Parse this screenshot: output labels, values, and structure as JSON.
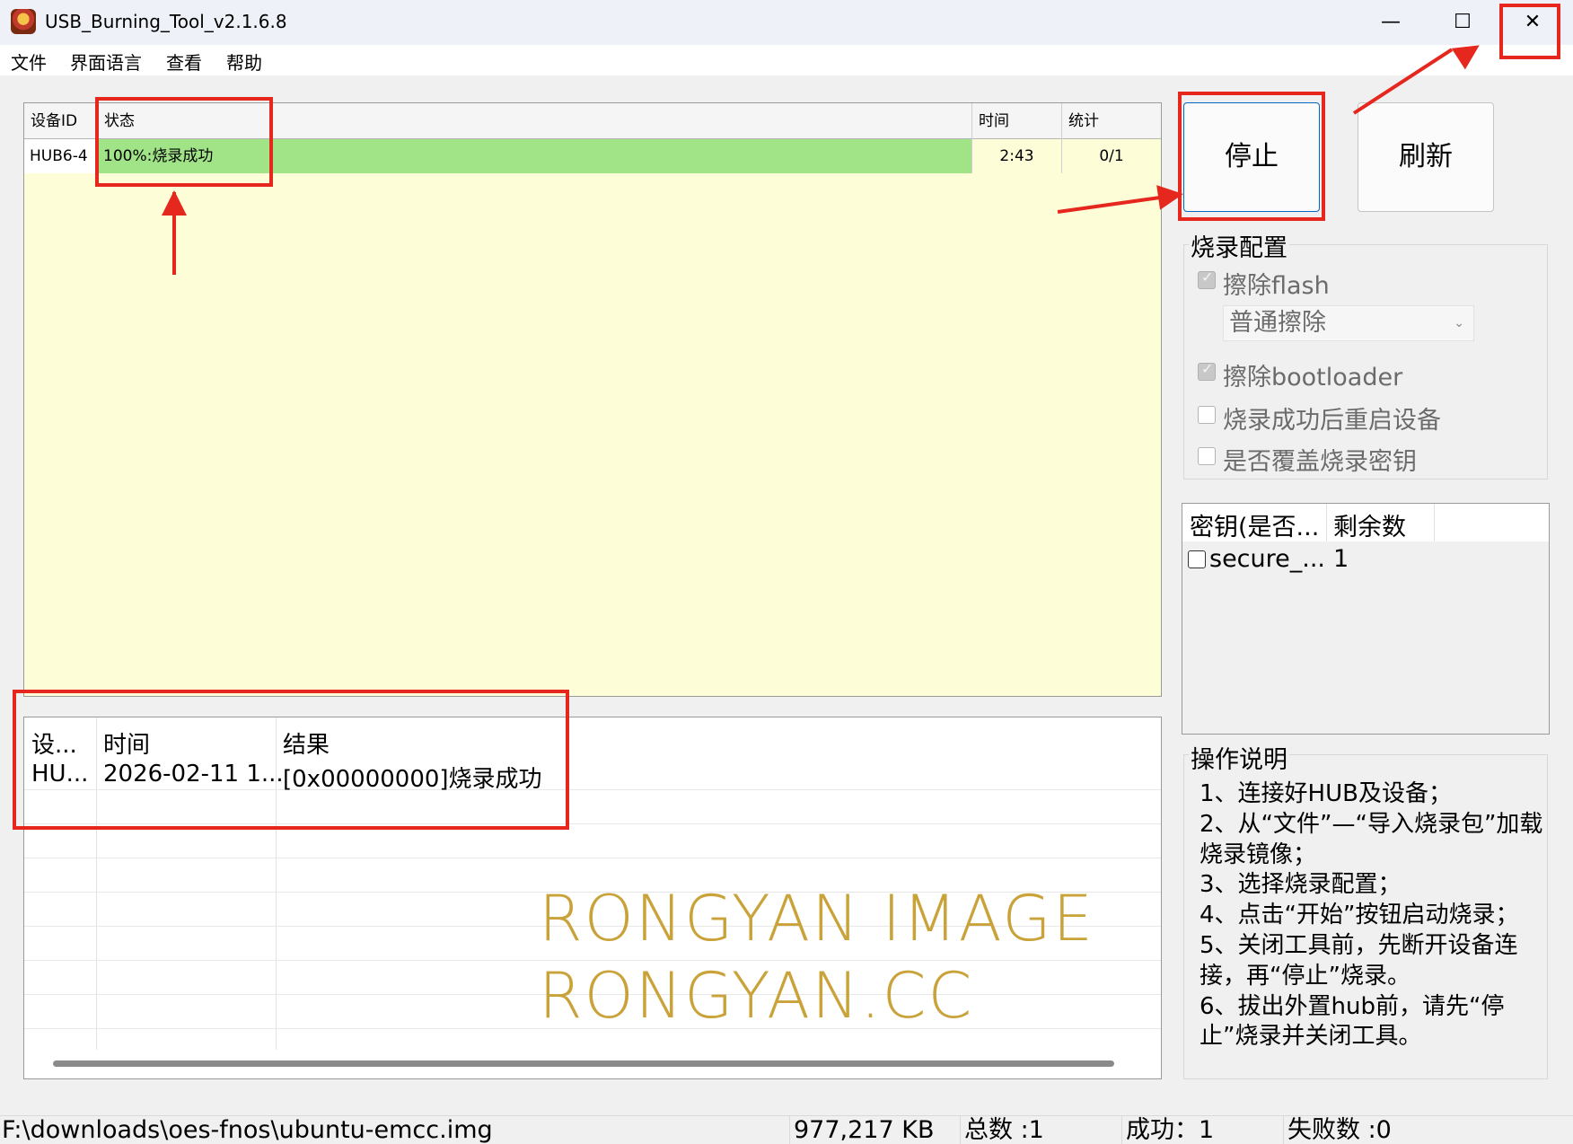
{
  "window": {
    "title": "USB_Burning_Tool_v2.1.6.8",
    "minimize_icon": "minimize-icon",
    "maximize_icon": "maximize-icon",
    "close_icon": "close-icon",
    "minimize_glyph": "—",
    "maximize_glyph": "☐",
    "close_glyph": "✕"
  },
  "menu": [
    "文件",
    "界面语言",
    "查看",
    "帮助"
  ],
  "device_table": {
    "columns": [
      "设备ID",
      "状态",
      "时间",
      "统计"
    ],
    "rows": [
      {
        "device_id": "HUB6-4",
        "status": "100%:烧录成功",
        "time": "2:43",
        "stats": "0/1",
        "status_color": "#a0e487"
      }
    ],
    "background_color": "#fdfdd8"
  },
  "log_table": {
    "columns": [
      "设...",
      "时间",
      "结果"
    ],
    "rows": [
      {
        "device": "HU...",
        "time": "2026-02-11 1...",
        "result": "[0x00000000]烧录成功"
      }
    ]
  },
  "watermark": {
    "line1": "RONGYAN IMAGE",
    "line2": "RONGYAN.CC",
    "color": "#c9a33a"
  },
  "buttons": {
    "stop": "停止",
    "refresh": "刷新"
  },
  "burn_config": {
    "title": "烧录配置",
    "erase_flash": {
      "label": "擦除flash",
      "checked": true,
      "disabled": true
    },
    "erase_mode": "普通擦除",
    "erase_bootloader": {
      "label": "擦除bootloader",
      "checked": true,
      "disabled": true
    },
    "reboot_after": {
      "label": "烧录成功后重启设备",
      "checked": false,
      "disabled": true
    },
    "overwrite_key": {
      "label": "是否覆盖烧录密钥",
      "checked": false,
      "disabled": true
    }
  },
  "key_table": {
    "columns": [
      "密钥(是否...",
      "剩余数"
    ],
    "rows": [
      {
        "key": "secure_...",
        "remaining": "1",
        "checked": false
      }
    ]
  },
  "instructions": {
    "title": "操作说明",
    "text": "1、连接好HUB及设备；\n2、从“文件”—“导入烧录包”加载烧录镜像；\n3、选择烧录配置；\n4、点击“开始”按钮启动烧录；\n5、关闭工具前，先断开设备连接，再“停止”烧录。\n6、拔出外置hub前，请先“停止”烧录并关闭工具。"
  },
  "status_bar": {
    "file_path": "F:\\downloads\\oes-fnos\\ubuntu-emcc.img",
    "size": "977,217 KB",
    "total": "总数 :1",
    "success": "成功：1",
    "failed": "失败数 :0"
  },
  "annotation_color": "#e5271e"
}
